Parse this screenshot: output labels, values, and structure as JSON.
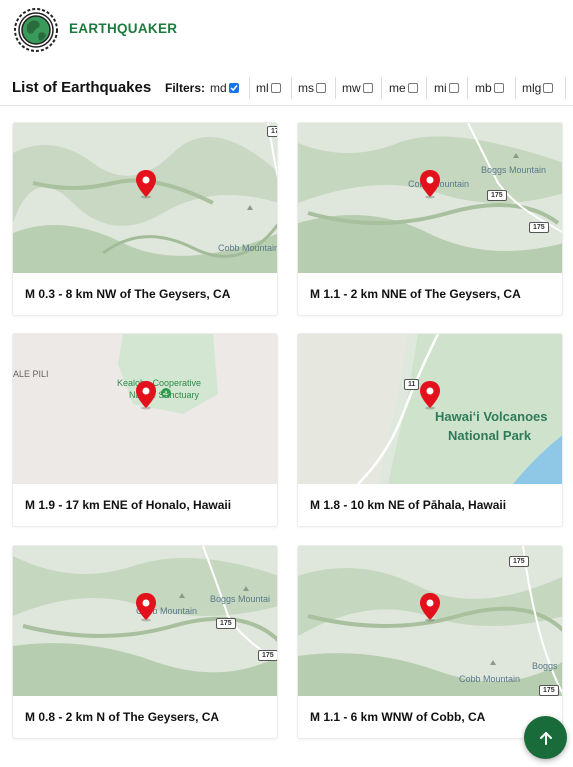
{
  "app": {
    "brand": "EARTHQUAKER"
  },
  "list": {
    "title": "List of Earthquakes",
    "filters_label": "Filters:"
  },
  "filters": [
    {
      "label": "md",
      "checked": true
    },
    {
      "label": "ml",
      "checked": false
    },
    {
      "label": "ms",
      "checked": false
    },
    {
      "label": "mw",
      "checked": false
    },
    {
      "label": "me",
      "checked": false
    },
    {
      "label": "mi",
      "checked": false
    },
    {
      "label": "mb",
      "checked": false
    },
    {
      "label": "mlg",
      "checked": false
    }
  ],
  "cards": [
    {
      "title": "M 0.3 - 8 km NW of The Geysers, CA",
      "map": {
        "style": "terrain",
        "labels": [
          "Cobb Mountain"
        ],
        "roads": [
          "17"
        ]
      }
    },
    {
      "title": "M 1.1 - 2 km NNE of The Geysers, CA",
      "map": {
        "style": "terrain",
        "labels": [
          "Boggs Mountain",
          "Cobb Mountain"
        ],
        "roads": [
          "175",
          "175"
        ]
      }
    },
    {
      "title": "M 1.9 - 17 km ENE of Honalo, Hawaii",
      "map": {
        "style": "plain",
        "labels": [
          "ALE PILI",
          "Kealoha Cooperative",
          "Nature Sanctuary"
        ]
      }
    },
    {
      "title": "M 1.8 - 10 km NE of Pāhala, Hawaii",
      "map": {
        "style": "terrain",
        "labels": [
          "Hawaiʻi Volcanoes",
          "National Park"
        ],
        "roads": [
          "11"
        ]
      }
    },
    {
      "title": "M 0.8 - 2 km N of The Geysers, CA",
      "map": {
        "style": "terrain",
        "labels": [
          "Boggs Mountai",
          "Cobb Mountain"
        ],
        "roads": [
          "175",
          "175"
        ]
      }
    },
    {
      "title": "M 1.1 - 6 km WNW of Cobb, CA",
      "map": {
        "style": "terrain",
        "labels": [
          "Boggs",
          "Cobb Mountain"
        ],
        "roads": [
          "175",
          "175"
        ]
      }
    }
  ],
  "colors": {
    "brand": "#1d7a3f",
    "pin": "#e3111b",
    "fab": "#1a6b3a",
    "checkbox": "#1a73e8"
  },
  "fab": {
    "icon": "arrow-up-icon"
  }
}
